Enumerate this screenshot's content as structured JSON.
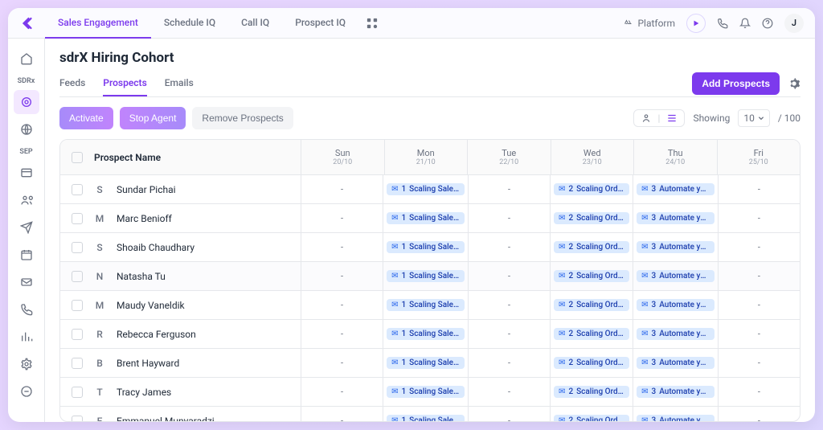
{
  "topnav": {
    "tabs": [
      "Sales Engagement",
      "Schedule IQ",
      "Call IQ",
      "Prospect IQ"
    ],
    "active": 0,
    "platform_label": "Platform",
    "avatar_initial": "J"
  },
  "sidebar": {
    "groups": [
      {
        "label": "SDRx",
        "items": [
          "home",
          "target",
          "globe"
        ]
      },
      {
        "label": "SEP",
        "items": [
          "inbox",
          "users",
          "send",
          "calendar",
          "mail",
          "phone",
          "chart",
          "settings",
          "minus"
        ]
      }
    ]
  },
  "page": {
    "title": "sdrX Hiring Cohort",
    "subtabs": [
      "Feeds",
      "Prospects",
      "Emails"
    ],
    "active_subtab": 1,
    "add_btn": "Add Prospects",
    "actions": {
      "activate": "Activate",
      "stop": "Stop Agent",
      "remove": "Remove Prospects"
    },
    "showing_label": "Showing",
    "showing_value": "10",
    "showing_total": "/ 100"
  },
  "table": {
    "name_header": "Prospect Name",
    "days": [
      {
        "label": "Sun",
        "date": "20/10"
      },
      {
        "label": "Mon",
        "date": "21/10"
      },
      {
        "label": "Tue",
        "date": "22/10"
      },
      {
        "label": "Wed",
        "date": "23/10"
      },
      {
        "label": "Thu",
        "date": "24/10"
      },
      {
        "label": "Fri",
        "date": "25/10"
      }
    ],
    "mon_chip": {
      "num": "1",
      "text": "Scaling Sales ..."
    },
    "wed_chip": {
      "num": "2",
      "text": "Scaling Order..."
    },
    "thu_chip": {
      "num": "3",
      "text": "Automate you..."
    },
    "rows": [
      {
        "initial": "S",
        "name": "Sundar Pichai"
      },
      {
        "initial": "M",
        "name": "Marc Benioff"
      },
      {
        "initial": "S",
        "name": "Shoaib Chaudhary"
      },
      {
        "initial": "N",
        "name": "Natasha Tu"
      },
      {
        "initial": "M",
        "name": "Maudy Vaneldik"
      },
      {
        "initial": "R",
        "name": "Rebecca Ferguson"
      },
      {
        "initial": "B",
        "name": "Brent Hayward"
      },
      {
        "initial": "T",
        "name": "Tracy James"
      },
      {
        "initial": "E",
        "name": "Emmanuel Munyaradzi"
      }
    ]
  }
}
